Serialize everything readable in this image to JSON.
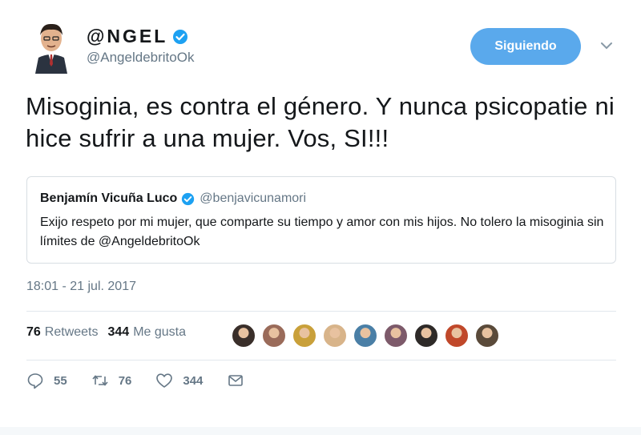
{
  "header": {
    "display_name": "@NGEL",
    "handle": "@AngeldebritoOk",
    "follow_label": "Siguiendo"
  },
  "tweet": {
    "text": "Misoginia, es contra el género. Y nunca psicopatie ni hice sufrir a una mujer. Vos, SI!!!",
    "timestamp": "18:01 - 21 jul. 2017"
  },
  "quote": {
    "name": "Benjamín Vicuña Luco",
    "handle": "@benjavicunamori",
    "text": "Exijo respeto por mi mujer, que comparte su tiempo y amor con mis hijos. No tolero la misoginia sin límites de @AngeldebritoOk"
  },
  "stats": {
    "retweets_count": "76",
    "retweets_label": "Retweets",
    "likes_count": "344",
    "likes_label": "Me gusta"
  },
  "likers": [
    {
      "icon": "liker-avatar",
      "color": "#3a2f2a"
    },
    {
      "icon": "liker-avatar",
      "color": "#9a6b5a"
    },
    {
      "icon": "liker-avatar",
      "color": "#c9a03a"
    },
    {
      "icon": "liker-avatar",
      "color": "#d8b48a"
    },
    {
      "icon": "liker-avatar",
      "color": "#4a7fa6"
    },
    {
      "icon": "liker-avatar",
      "color": "#7d5a6a"
    },
    {
      "icon": "liker-avatar",
      "color": "#2e2a28"
    },
    {
      "icon": "liker-avatar",
      "color": "#c0482a"
    },
    {
      "icon": "liker-avatar",
      "color": "#5a4a3a"
    }
  ],
  "actions": {
    "reply_count": "55",
    "retweet_count": "76",
    "like_count": "344"
  },
  "colors": {
    "accent": "#1da1f2",
    "follow_button": "#5aa9ec",
    "secondary_text": "#657786",
    "border": "#e1e8ed"
  }
}
